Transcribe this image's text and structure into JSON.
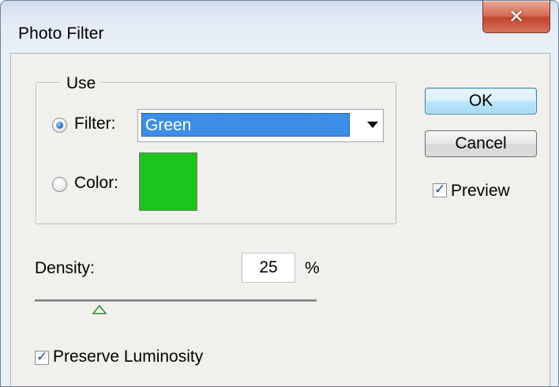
{
  "window": {
    "title": "Photo Filter",
    "close_glyph": "✕"
  },
  "use_group": {
    "legend": "Use",
    "filter": {
      "label": "Filter:",
      "selected": true,
      "value": "Green"
    },
    "color": {
      "label": "Color:",
      "selected": false,
      "swatch": "#1dc41b"
    }
  },
  "buttons": {
    "ok": "OK",
    "cancel": "Cancel"
  },
  "preview": {
    "label": "Preview",
    "checked": true
  },
  "density": {
    "label": "Density:",
    "value": "25",
    "unit": "%",
    "slider_fraction": 0.25
  },
  "preserve": {
    "label": "Preserve Luminosity",
    "checked": true
  },
  "icons": {
    "close": "close-icon",
    "dropdown": "chevron-down-icon",
    "check": "checkmark-icon"
  }
}
